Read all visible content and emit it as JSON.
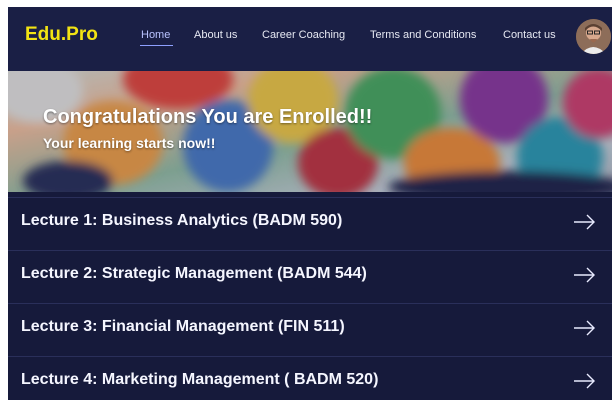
{
  "brand": {
    "logo_text": "Edu.Pro"
  },
  "nav": {
    "items": [
      {
        "label": "Home",
        "active": true
      },
      {
        "label": "About us",
        "active": false
      },
      {
        "label": "Career Coaching",
        "active": false
      },
      {
        "label": "Terms and Conditions",
        "active": false
      },
      {
        "label": "Contact us",
        "active": false
      }
    ]
  },
  "banner": {
    "title": "Congratulations You are Enrolled!!",
    "subtitle": "Your learning starts now!!"
  },
  "lectures": [
    {
      "label": "Lecture 1: Business Analytics (BADM 590)"
    },
    {
      "label": "Lecture 2: Strategic Management (BADM 544)"
    },
    {
      "label": "Lecture 3: Financial Management (FIN 511)"
    },
    {
      "label": "Lecture 4: Marketing Management ( BADM 520)"
    }
  ],
  "icons": {
    "arrow": "arrow-right-icon",
    "avatar": "user-avatar"
  },
  "colors": {
    "background": "#161a3b",
    "nav_background": "#1a1f45",
    "logo": "#f2e313",
    "active_link": "#b9c3ff"
  }
}
